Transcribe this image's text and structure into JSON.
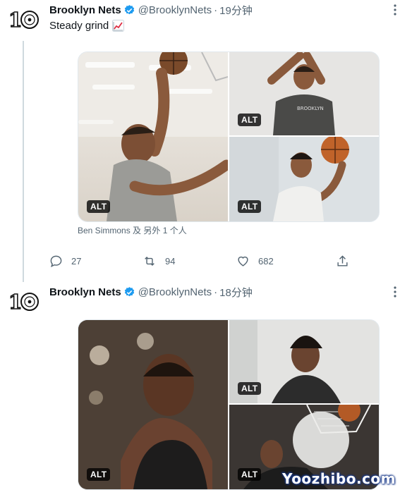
{
  "tweets": [
    {
      "author_name": "Brooklyn Nets",
      "handle": "@BrooklynNets",
      "separator": "·",
      "time": "19分钟",
      "text": "Steady grind",
      "emoji_icon": "chart-increasing-icon",
      "photos": [
        {
          "alt": "ALT",
          "subject": "basketball-dunk-practice"
        },
        {
          "alt": "",
          "subject": "player-shooting-jersey"
        },
        {
          "alt": "ALT",
          "subject": "player-shooting-ball"
        }
      ],
      "tagged": "Ben Simmons 及 另外 1 个人",
      "reply_count": "27",
      "retweet_count": "94",
      "like_count": "682"
    },
    {
      "author_name": "Brooklyn Nets",
      "handle": "@BrooklynNets",
      "separator": "·",
      "time": "18分钟",
      "photos": [
        {
          "alt": "ALT",
          "subject": "player-smiling-portrait"
        },
        {
          "alt": "ALT",
          "subject": "player-braids-portrait"
        },
        {
          "alt": "ALT",
          "subject": "player-layup-hoop"
        }
      ]
    }
  ],
  "watermark": "Yoozhibo.com",
  "colors": {
    "verified": "#1d9bf0",
    "muted_text": "#536471",
    "primary_text": "#0f1419",
    "thread_line": "#cfd9de"
  }
}
